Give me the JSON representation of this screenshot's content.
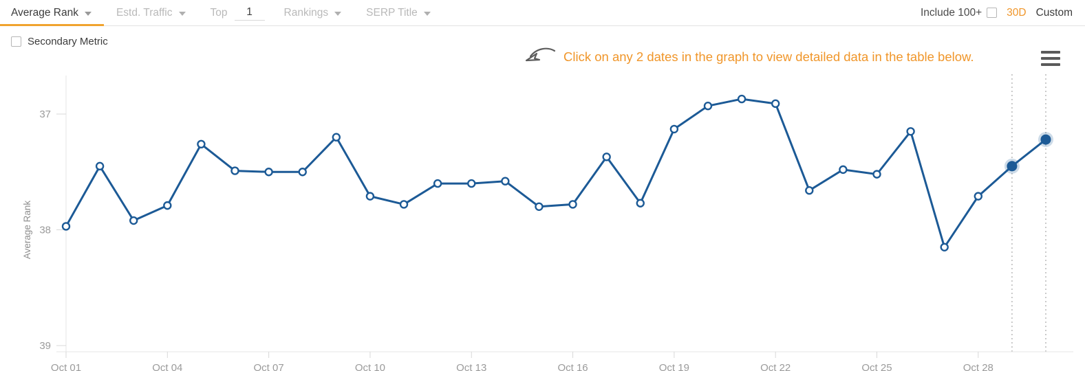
{
  "toolbar": {
    "tabs": [
      {
        "label": "Average Rank",
        "active": true,
        "icon": "chevron-down-icon"
      },
      {
        "label": "Estd. Traffic",
        "active": false,
        "icon": "chevron-down-icon"
      },
      {
        "label": "Rankings",
        "active": false,
        "icon": "chevron-down-icon"
      },
      {
        "label": "SERP Title",
        "active": false,
        "icon": "chevron-down-icon"
      }
    ],
    "top_label": "Top",
    "top_value": "1",
    "include_100_label": "Include 100+",
    "include_100_checked": false,
    "range_30d": "30D",
    "range_custom": "Custom",
    "active_range": "30D",
    "accent_color": "#f0962a",
    "active_tab_underline_color": "#f0a32e"
  },
  "secondary_metric": {
    "label": "Secondary Metric",
    "checked": false
  },
  "callout": {
    "icon": "curved-arrow-icon",
    "text": "Click on any 2 dates in the graph to view detailed data in the table below.",
    "color": "#f0962a"
  },
  "menu": {
    "icon": "hamburger-menu-icon"
  },
  "chart_data": {
    "type": "line",
    "title": "",
    "xlabel": "",
    "ylabel": "Average Rank",
    "ylim": [
      37,
      39
    ],
    "y_inverted": true,
    "yticks": [
      37,
      38,
      39
    ],
    "ytick_labels": [
      "37",
      "38",
      "39"
    ],
    "grid": false,
    "legend": null,
    "line_color": "#1c5a96",
    "marker": "open-circle",
    "selected_marker_color": "#1c5a96",
    "selected_indices": [
      28,
      29
    ],
    "x": [
      "Oct 01",
      "Oct 02",
      "Oct 03",
      "Oct 04",
      "Oct 05",
      "Oct 06",
      "Oct 07",
      "Oct 08",
      "Oct 09",
      "Oct 10",
      "Oct 11",
      "Oct 12",
      "Oct 13",
      "Oct 14",
      "Oct 15",
      "Oct 16",
      "Oct 17",
      "Oct 18",
      "Oct 19",
      "Oct 20",
      "Oct 21",
      "Oct 22",
      "Oct 23",
      "Oct 24",
      "Oct 25",
      "Oct 26",
      "Oct 27",
      "Oct 28",
      "Oct 29",
      "Oct 30"
    ],
    "xtick_labels": [
      "Oct 01",
      "Oct 04",
      "Oct 07",
      "Oct 10",
      "Oct 13",
      "Oct 16",
      "Oct 19",
      "Oct 22",
      "Oct 25",
      "Oct 28"
    ],
    "xtick_indices": [
      0,
      3,
      6,
      9,
      12,
      15,
      18,
      21,
      24,
      27
    ],
    "values": [
      37.97,
      37.45,
      37.92,
      37.79,
      37.26,
      37.49,
      37.5,
      37.5,
      37.2,
      37.71,
      37.78,
      37.6,
      37.6,
      37.58,
      37.8,
      37.78,
      37.37,
      37.77,
      37.13,
      36.93,
      36.87,
      36.91,
      37.66,
      37.48,
      37.52,
      37.15,
      38.15,
      37.71,
      37.45,
      37.22
    ],
    "series": [
      {
        "name": "Average Rank",
        "values": [
          37.97,
          37.45,
          37.92,
          37.79,
          37.26,
          37.49,
          37.5,
          37.5,
          37.2,
          37.71,
          37.78,
          37.6,
          37.6,
          37.58,
          37.8,
          37.78,
          37.37,
          37.77,
          37.13,
          36.93,
          36.87,
          36.91,
          37.66,
          37.48,
          37.52,
          37.15,
          38.15,
          37.71,
          37.45,
          37.22
        ]
      }
    ]
  }
}
